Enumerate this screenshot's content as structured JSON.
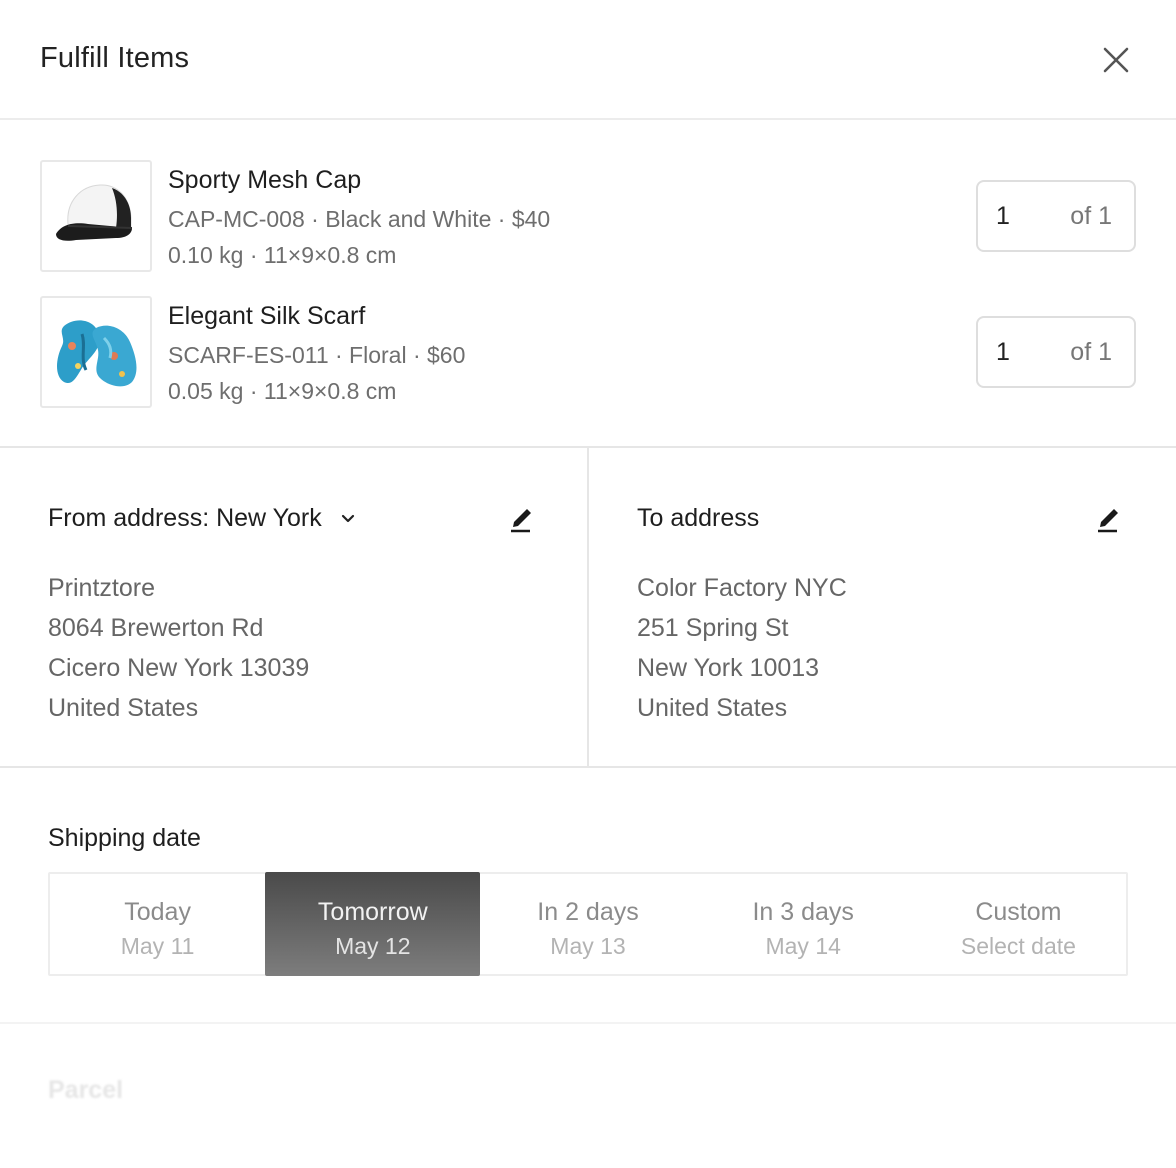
{
  "header": {
    "title": "Fulfill Items"
  },
  "items": [
    {
      "name": "Sporty Mesh Cap",
      "meta": "CAP-MC-008 · Black and White · $40",
      "dims": "0.10 kg · 11×9×0.8 cm",
      "qty": "1",
      "of": "of 1",
      "thumb_icon": "cap-icon"
    },
    {
      "name": "Elegant Silk Scarf",
      "meta": "SCARF-ES-011 · Floral · $60",
      "dims": "0.05 kg · 11×9×0.8 cm",
      "qty": "1",
      "of": "of 1",
      "thumb_icon": "scarf-icon"
    }
  ],
  "from_address": {
    "heading": "From address: New York",
    "lines": [
      "Printztore",
      "8064 Brewerton Rd",
      "Cicero New York 13039",
      "United States"
    ]
  },
  "to_address": {
    "heading": "To address",
    "lines": [
      "Color Factory NYC",
      "251 Spring St",
      "New York 10013",
      "United States"
    ]
  },
  "shipping": {
    "title": "Shipping date",
    "options": [
      {
        "label": "Today",
        "sub": "May 11",
        "selected": false
      },
      {
        "label": "Tomorrow",
        "sub": "May 12",
        "selected": true
      },
      {
        "label": "In 2 days",
        "sub": "May 13",
        "selected": false
      },
      {
        "label": "In 3 days",
        "sub": "May 14",
        "selected": false
      },
      {
        "label": "Custom",
        "sub": "Select date",
        "selected": false
      }
    ]
  },
  "parcel": {
    "title": "Parcel"
  },
  "colors": {
    "selected_option": "#5c5c5c",
    "border": "#e6e6e6",
    "muted_text": "#6e6e6e"
  }
}
